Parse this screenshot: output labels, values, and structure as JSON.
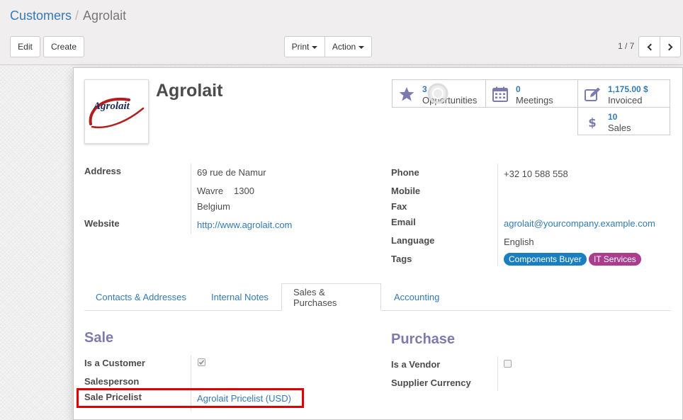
{
  "breadcrumb": {
    "parent": "Customers",
    "separator": "/",
    "current": "Agrolait"
  },
  "toolbar": {
    "edit": "Edit",
    "create": "Create",
    "print": "Print",
    "action": "Action"
  },
  "pager": {
    "value": "1 / 7"
  },
  "partner": {
    "name": "Agrolait",
    "logo_text": "Agrolait"
  },
  "smart_buttons": {
    "opportunities": {
      "value": "3",
      "label": "Opportunities"
    },
    "meetings": {
      "value": "0",
      "label": "Meetings"
    },
    "invoiced": {
      "value": "1,175.00 $",
      "label": "Invoiced"
    },
    "sales": {
      "value": "10",
      "label": "Sales"
    }
  },
  "fields": {
    "address_label": "Address",
    "street": "69 rue de Namur",
    "city": "Wavre",
    "zip": "1300",
    "country": "Belgium",
    "website_label": "Website",
    "website": "http://www.agrolait.com",
    "phone_label": "Phone",
    "phone": "+32 10 588 558",
    "mobile_label": "Mobile",
    "fax_label": "Fax",
    "email_label": "Email",
    "email": "agrolait@yourcompany.example.com",
    "language_label": "Language",
    "language": "English",
    "tags_label": "Tags",
    "tags": [
      "Components Buyer",
      "IT Services"
    ]
  },
  "tabs": [
    "Contacts & Addresses",
    "Internal Notes",
    "Sales & Purchases",
    "Accounting"
  ],
  "sale": {
    "title": "Sale",
    "is_customer_label": "Is a Customer",
    "salesperson_label": "Salesperson",
    "pricelist_label": "Sale Pricelist",
    "pricelist": "Agrolait Pricelist (USD)"
  },
  "purchase": {
    "title": "Purchase",
    "is_vendor_label": "Is a Vendor",
    "currency_label": "Supplier Currency"
  },
  "colors": {
    "link": "#337ab7",
    "tag_components": "#1a7fc1",
    "tag_it": "#ab3d8e",
    "section_title": "#7c7bad",
    "highlight": "#e00000"
  }
}
